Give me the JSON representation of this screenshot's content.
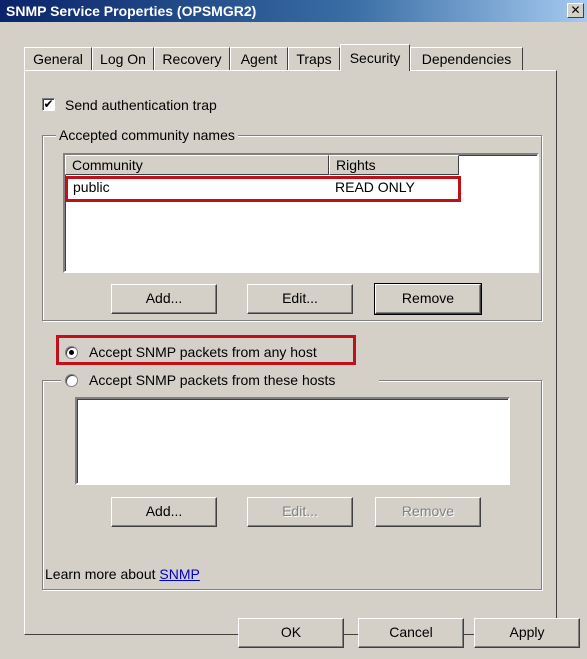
{
  "window": {
    "title": "SNMP Service Properties (OPSMGR2)",
    "close_glyph": "✕"
  },
  "tabs": [
    {
      "label": "General"
    },
    {
      "label": "Log On"
    },
    {
      "label": "Recovery"
    },
    {
      "label": "Agent"
    },
    {
      "label": "Traps"
    },
    {
      "label": "Security"
    },
    {
      "label": "Dependencies"
    }
  ],
  "active_tab": "Security",
  "security": {
    "send_auth_trap": {
      "label": "Send authentication trap",
      "checked": true,
      "check_glyph": "✔"
    },
    "community_group": {
      "label": "Accepted community names",
      "columns": [
        "Community",
        "Rights"
      ],
      "rows": [
        {
          "community": "public",
          "rights": "READ ONLY"
        }
      ],
      "buttons": {
        "add": "Add...",
        "edit": "Edit...",
        "remove": "Remove"
      }
    },
    "accept_any": {
      "label": "Accept SNMP packets from any host",
      "selected": true
    },
    "accept_these": {
      "label": "Accept SNMP packets from these hosts",
      "selected": false,
      "hosts": [],
      "buttons": {
        "add": "Add...",
        "edit": "Edit...",
        "remove": "Remove"
      }
    },
    "learn_more": {
      "prefix": "Learn more about ",
      "link": "SNMP"
    }
  },
  "footer": {
    "ok": "OK",
    "cancel": "Cancel",
    "apply": "Apply"
  },
  "colors": {
    "annotation_red": "#c0111a",
    "link_blue": "#0000cc",
    "dialog_bg": "#d4d0c8"
  }
}
